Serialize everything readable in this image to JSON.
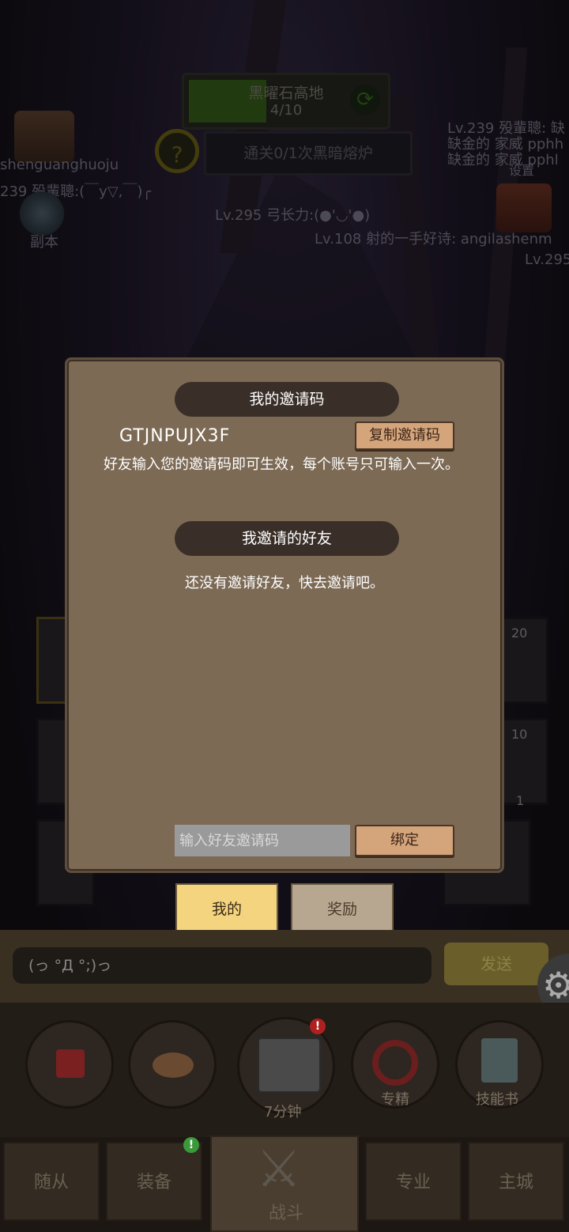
{
  "hud": {
    "stage_name": "黑曜石高地",
    "stage_progress": "4/10",
    "stage_progress_fraction": 0.4,
    "quest_text": "通关0/1次黑暗熔炉",
    "quest_icon_glyph": "?",
    "left_player_name": "shenguanghuoju",
    "left_player_chat": "239 殁輩聰:(￣y▽,￣)╭",
    "dungeon_label": "副本",
    "chat_line_1": "Lv.295 弓长力:(●'◡'●)",
    "chat_line_2": "Lv.108 射的一手好诗: angilashenm",
    "chat_line_3": "Lv.295",
    "right_line_1": "Lv.239 殁輩聰: 缺",
    "right_line_2": "缺金的 家威 pphh",
    "right_line_3": "缺金的 家威 pphl",
    "settings_label": "设置"
  },
  "dialog": {
    "my_code_title": "我的邀请码",
    "invite_code": "GTJNPUJX3F",
    "copy_button": "复制邀请码",
    "info_text": "好友输入您的邀请码即可生效，每个账号只可输入一次。",
    "friends_title": "我邀请的好友",
    "empty_text": "还没有邀请好友，快去邀请吧。",
    "input_placeholder": "输入好友邀请码",
    "bind_button": "绑定"
  },
  "tabs": {
    "mine": "我的",
    "rewards": "奖励"
  },
  "slots": {
    "count_a": "20",
    "count_b": "10",
    "count_c": "1"
  },
  "chat": {
    "input_text": "(っ °Д °;)っ",
    "send_button": "发送",
    "gear_glyph": "⚙"
  },
  "actions": {
    "chest_timer": "7分钟",
    "specialize": "专精",
    "skill_book": "技能书",
    "chest_badge": "!",
    "equip_badge": "!"
  },
  "nav": {
    "followers": "随从",
    "equipment": "装备",
    "battle": "战斗",
    "profession": "专业",
    "main_city": "主城",
    "swords_glyph": "⚔"
  }
}
